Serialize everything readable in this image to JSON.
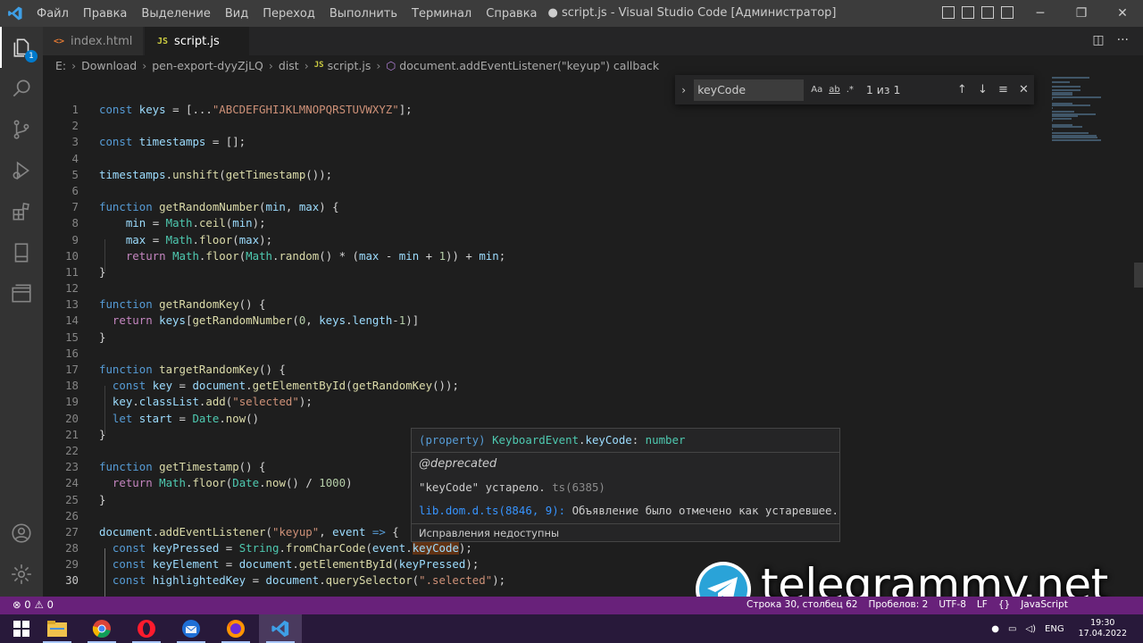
{
  "window": {
    "title": "● script.js - Visual Studio Code [Администратор]",
    "menu": [
      "Файл",
      "Правка",
      "Выделение",
      "Вид",
      "Переход",
      "Выполнить",
      "Терминал",
      "Справка"
    ]
  },
  "activity_bar": {
    "items": [
      "explorer-icon",
      "search-icon",
      "source-control-icon",
      "run-debug-icon",
      "extensions-icon",
      "notebook-icon",
      "remote-explorer-icon"
    ],
    "explorer_badge": "1",
    "bottom": [
      "account-icon",
      "manage-gear-icon"
    ]
  },
  "tabs": [
    {
      "label": "index.html",
      "icon_text": "<>",
      "icon_color": "#e37933"
    },
    {
      "label": "script.js",
      "icon_text": "JS",
      "icon_color": "#cbcb41",
      "dirty": true
    }
  ],
  "breadcrumb": [
    "E:",
    "Download",
    "pen-export-dyyZjLQ",
    "dist",
    "script.js",
    "document.addEventListener(\"keyup\") callback"
  ],
  "breadcrumb_js": "JS",
  "find": {
    "value": "keyCode",
    "opts": [
      "Aa",
      "ab",
      ".*"
    ],
    "count": "1 из 1"
  },
  "editor": {
    "current_line": 30,
    "lines": [
      {
        "n": "1",
        "t": [
          [
            "kw",
            "const "
          ],
          [
            "var",
            "keys"
          ],
          [
            "pl",
            " = [..."
          ],
          [
            "str",
            "\"ABCDEFGHIJKLMNOPQRSTUVWXYZ\""
          ],
          [
            "pl",
            "];"
          ]
        ]
      },
      {
        "n": "2",
        "t": []
      },
      {
        "n": "3",
        "t": [
          [
            "kw",
            "const "
          ],
          [
            "var",
            "timestamps"
          ],
          [
            "pl",
            " = [];"
          ]
        ]
      },
      {
        "n": "4",
        "t": []
      },
      {
        "n": "5",
        "t": [
          [
            "var",
            "timestamps"
          ],
          [
            "pl",
            "."
          ],
          [
            "fn",
            "unshift"
          ],
          [
            "pl",
            "("
          ],
          [
            "fn",
            "getTimestamp"
          ],
          [
            "pl",
            "());"
          ]
        ]
      },
      {
        "n": "6",
        "t": []
      },
      {
        "n": "7",
        "t": [
          [
            "kw",
            "function "
          ],
          [
            "fn",
            "getRandomNumber"
          ],
          [
            "pl",
            "("
          ],
          [
            "var",
            "min"
          ],
          [
            "pl",
            ", "
          ],
          [
            "var",
            "max"
          ],
          [
            "pl",
            ") {"
          ]
        ]
      },
      {
        "n": "8",
        "t": [
          [
            "pl",
            "    "
          ],
          [
            "var",
            "min"
          ],
          [
            "pl",
            " = "
          ],
          [
            "cls",
            "Math"
          ],
          [
            "pl",
            "."
          ],
          [
            "fn",
            "ceil"
          ],
          [
            "pl",
            "("
          ],
          [
            "var",
            "min"
          ],
          [
            "pl",
            ");"
          ]
        ]
      },
      {
        "n": "9",
        "t": [
          [
            "pl",
            "    "
          ],
          [
            "var",
            "max"
          ],
          [
            "pl",
            " = "
          ],
          [
            "cls",
            "Math"
          ],
          [
            "pl",
            "."
          ],
          [
            "fn",
            "floor"
          ],
          [
            "pl",
            "("
          ],
          [
            "var",
            "max"
          ],
          [
            "pl",
            ");"
          ]
        ]
      },
      {
        "n": "10",
        "t": [
          [
            "pl",
            "    "
          ],
          [
            "kw2",
            "return "
          ],
          [
            "cls",
            "Math"
          ],
          [
            "pl",
            "."
          ],
          [
            "fn",
            "floor"
          ],
          [
            "pl",
            "("
          ],
          [
            "cls",
            "Math"
          ],
          [
            "pl",
            "."
          ],
          [
            "fn",
            "random"
          ],
          [
            "pl",
            "() * ("
          ],
          [
            "var",
            "max"
          ],
          [
            "pl",
            " - "
          ],
          [
            "var",
            "min"
          ],
          [
            "pl",
            " + "
          ],
          [
            "num2",
            "1"
          ],
          [
            "pl",
            ")) + "
          ],
          [
            "var",
            "min"
          ],
          [
            "pl",
            ";"
          ]
        ]
      },
      {
        "n": "11",
        "t": [
          [
            "pl",
            "}"
          ]
        ]
      },
      {
        "n": "12",
        "t": []
      },
      {
        "n": "13",
        "t": [
          [
            "kw",
            "function "
          ],
          [
            "fn",
            "getRandomKey"
          ],
          [
            "pl",
            "() {"
          ]
        ]
      },
      {
        "n": "14",
        "t": [
          [
            "pl",
            "  "
          ],
          [
            "kw2",
            "return "
          ],
          [
            "var",
            "keys"
          ],
          [
            "pl",
            "["
          ],
          [
            "fn",
            "getRandomNumber"
          ],
          [
            "pl",
            "("
          ],
          [
            "num2",
            "0"
          ],
          [
            "pl",
            ", "
          ],
          [
            "var",
            "keys"
          ],
          [
            "pl",
            "."
          ],
          [
            "var",
            "length"
          ],
          [
            "pl",
            "-"
          ],
          [
            "num2",
            "1"
          ],
          [
            "pl",
            ")]"
          ]
        ]
      },
      {
        "n": "15",
        "t": [
          [
            "pl",
            "}"
          ]
        ]
      },
      {
        "n": "16",
        "t": []
      },
      {
        "n": "17",
        "t": [
          [
            "kw",
            "function "
          ],
          [
            "fn",
            "targetRandomKey"
          ],
          [
            "pl",
            "() {"
          ]
        ]
      },
      {
        "n": "18",
        "t": [
          [
            "pl",
            "  "
          ],
          [
            "kw",
            "const "
          ],
          [
            "var",
            "key"
          ],
          [
            "pl",
            " = "
          ],
          [
            "var",
            "document"
          ],
          [
            "pl",
            "."
          ],
          [
            "fn",
            "getElementById"
          ],
          [
            "pl",
            "("
          ],
          [
            "fn",
            "getRandomKey"
          ],
          [
            "pl",
            "());"
          ]
        ]
      },
      {
        "n": "19",
        "t": [
          [
            "pl",
            "  "
          ],
          [
            "var",
            "key"
          ],
          [
            "pl",
            "."
          ],
          [
            "var",
            "classList"
          ],
          [
            "pl",
            "."
          ],
          [
            "fn",
            "add"
          ],
          [
            "pl",
            "("
          ],
          [
            "str",
            "\"selected\""
          ],
          [
            "pl",
            ");"
          ]
        ]
      },
      {
        "n": "20",
        "t": [
          [
            "pl",
            "  "
          ],
          [
            "kw",
            "let "
          ],
          [
            "var",
            "start"
          ],
          [
            "pl",
            " = "
          ],
          [
            "cls",
            "Date"
          ],
          [
            "pl",
            "."
          ],
          [
            "fn",
            "now"
          ],
          [
            "pl",
            "()"
          ]
        ]
      },
      {
        "n": "21",
        "t": [
          [
            "pl",
            "}"
          ]
        ]
      },
      {
        "n": "22",
        "t": []
      },
      {
        "n": "23",
        "t": [
          [
            "kw",
            "function "
          ],
          [
            "fn",
            "getTimestamp"
          ],
          [
            "pl",
            "() {"
          ]
        ]
      },
      {
        "n": "24",
        "t": [
          [
            "pl",
            "  "
          ],
          [
            "kw2",
            "return "
          ],
          [
            "cls",
            "Math"
          ],
          [
            "pl",
            "."
          ],
          [
            "fn",
            "floor"
          ],
          [
            "pl",
            "("
          ],
          [
            "cls",
            "Date"
          ],
          [
            "pl",
            "."
          ],
          [
            "fn",
            "now"
          ],
          [
            "pl",
            "() / "
          ],
          [
            "num2",
            "1000"
          ],
          [
            "pl",
            ")"
          ]
        ]
      },
      {
        "n": "25",
        "t": [
          [
            "pl",
            "}"
          ]
        ]
      },
      {
        "n": "26",
        "t": []
      },
      {
        "n": "27",
        "t": [
          [
            "var",
            "document"
          ],
          [
            "pl",
            "."
          ],
          [
            "fn",
            "addEventListener"
          ],
          [
            "pl",
            "("
          ],
          [
            "str",
            "\"keyup\""
          ],
          [
            "pl",
            ", "
          ],
          [
            "var",
            "event"
          ],
          [
            "kw",
            " => "
          ],
          [
            "pl",
            "{"
          ]
        ]
      },
      {
        "n": "28",
        "t": [
          [
            "pl",
            "  "
          ],
          [
            "kw",
            "const "
          ],
          [
            "var",
            "keyPressed"
          ],
          [
            "pl",
            " = "
          ],
          [
            "cls",
            "String"
          ],
          [
            "pl",
            "."
          ],
          [
            "fn",
            "fromCharCode"
          ],
          [
            "pl",
            "("
          ],
          [
            "var",
            "event"
          ],
          [
            "pl",
            "."
          ],
          [
            "hl",
            "keyCode"
          ],
          [
            "pl",
            ");"
          ]
        ]
      },
      {
        "n": "29",
        "t": [
          [
            "pl",
            "  "
          ],
          [
            "kw",
            "const "
          ],
          [
            "var",
            "keyElement"
          ],
          [
            "pl",
            " = "
          ],
          [
            "var",
            "document"
          ],
          [
            "pl",
            "."
          ],
          [
            "fn",
            "getElementById"
          ],
          [
            "pl",
            "("
          ],
          [
            "var",
            "keyPressed"
          ],
          [
            "pl",
            ");"
          ]
        ]
      },
      {
        "n": "30",
        "t": [
          [
            "pl",
            "  "
          ],
          [
            "kw",
            "const "
          ],
          [
            "var",
            "highlightedKey"
          ],
          [
            "pl",
            " = "
          ],
          [
            "var",
            "document"
          ],
          [
            "pl",
            "."
          ],
          [
            "fn",
            "querySelector"
          ],
          [
            "pl",
            "("
          ],
          [
            "str",
            "\".selected\""
          ],
          [
            "pl",
            ");"
          ]
        ]
      }
    ]
  },
  "hover": {
    "signature_a": "(property) ",
    "signature_b": "KeyboardEvent",
    "signature_c": ".",
    "signature_d": "keyCode",
    "signature_e": ": ",
    "signature_f": "number",
    "deprecated": "@deprecated",
    "msg_a": "\"keyCode\" устарело.",
    "msg_b": " ts(6385)",
    "link": "lib.dom.d.ts(8846, 9):",
    "link_msg": " Объявление было отмечено как устаревшее.",
    "footer": "Исправления недоступны"
  },
  "watermark": "telegrammy.net",
  "statusbar": {
    "errors": "⊗ 0",
    "warnings": "⚠ 0",
    "right": [
      "Строка 30, столбец 62",
      "Пробелов: 2",
      "UTF-8",
      "LF",
      "{}",
      "JavaScript"
    ]
  },
  "taskbar": {
    "apps": [
      "windows-start-icon",
      "file-explorer-icon",
      "chrome-icon",
      "opera-icon",
      "thunderbird-icon",
      "firefox-icon",
      "vscode-icon"
    ],
    "lang": "ENG",
    "time": "19:30",
    "date": "17.04.2022"
  },
  "colors": {
    "statusbar": "#68217a",
    "activity_bar": "#333333",
    "editor_bg": "#1e1e1e"
  }
}
